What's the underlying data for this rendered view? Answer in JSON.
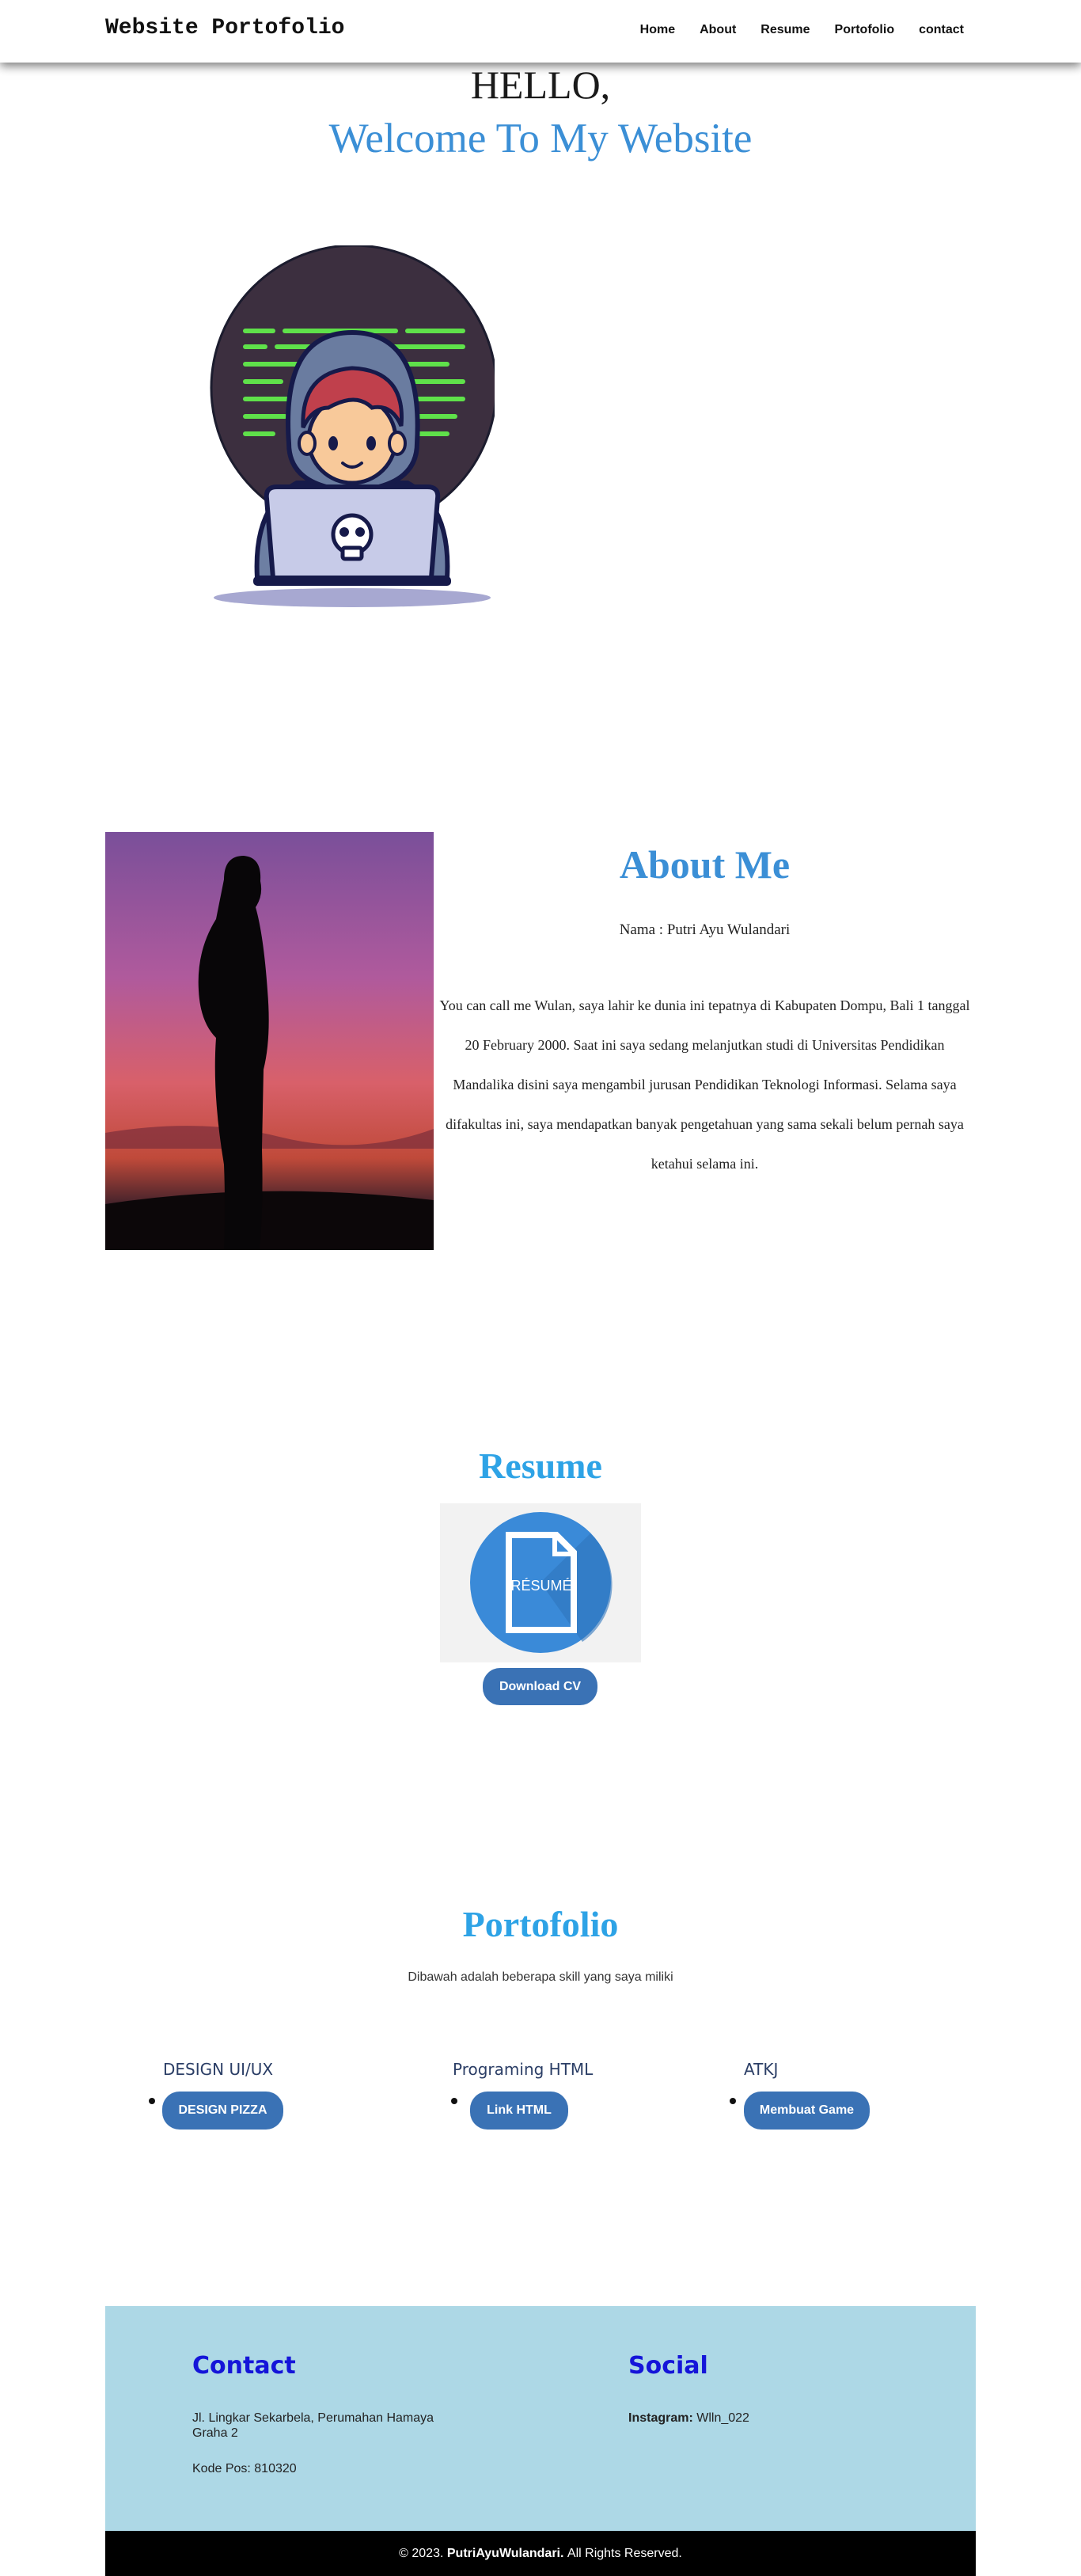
{
  "header": {
    "brand": "Website Portofolio",
    "nav": [
      "Home",
      "About",
      "Resume",
      "Portofolio",
      "contact"
    ]
  },
  "hero": {
    "greeting": "HELLO,",
    "welcome": "Welcome To My Website"
  },
  "about": {
    "title": "About Me",
    "name": "Nama : Putri Ayu Wulandari",
    "description": "You can call me Wulan, saya lahir ke dunia ini tepatnya di Kabupaten Dompu, Bali 1 tanggal 20 February 2000. Saat ini saya sedang melanjutkan studi di Universitas Pendidikan Mandalika disini saya mengambil jurusan Pendidikan Teknologi Informasi. Selama saya difakultas ini, saya mendapatkan banyak pengetahuan yang sama sekali belum pernah saya ketahui selama ini."
  },
  "resume": {
    "title": "Resume",
    "icon_text": "RÉSUMÉ",
    "download_label": "Download CV"
  },
  "portfolio": {
    "title": "Portofolio",
    "subtitle": "Dibawah adalah beberapa skill yang saya miliki",
    "skills": [
      {
        "title": "DESIGN UI/UX",
        "button": "DESIGN PIZZA"
      },
      {
        "title": "Programing HTML",
        "button": "Link HTML"
      },
      {
        "title": "ATKJ",
        "button": "Membuat Game"
      }
    ]
  },
  "footer": {
    "contact_title": "Contact",
    "address": "Jl. Lingkar Sekarbela, Perumahan Hamaya Graha 2",
    "postal": "Kode Pos: 810320",
    "social_title": "Social",
    "instagram_label": "Instagram:",
    "instagram_value": "Wlln_022",
    "copyright_prefix": "© 2023.",
    "copyright_name": "PutriAyuWulandari.",
    "copyright_suffix": "All Rights Reserved."
  },
  "colors": {
    "accent_blue": "#3b8fd6",
    "button_blue": "#3a72b5",
    "heading_sky": "#2ea3e6",
    "footer_bg": "#add8e6",
    "footer_heading": "#1515d9"
  }
}
